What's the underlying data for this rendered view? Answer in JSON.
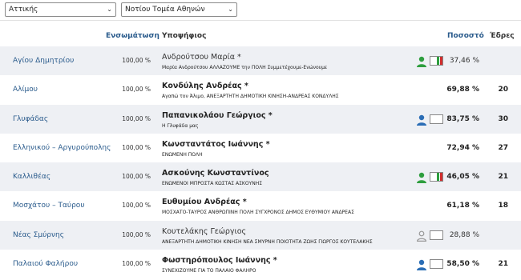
{
  "filters": {
    "region": "Αττικής",
    "sector": "Νοτίου Τομέα Αθηνών"
  },
  "header": {
    "integration": "Ενσωμάτωση",
    "candidate": "Υποψήφιος",
    "percentage": "Ποσοστό",
    "seats": "Έδρες"
  },
  "colors": {
    "link": "#2a5b8c",
    "row_alt": "#eef0f4",
    "elected_icon": "#2e9e3e",
    "leading_icon": "#2a6db5",
    "trailing_icon": "#999999",
    "bar_green": "#2e9e3e",
    "bar_red": "#d22d2d"
  },
  "rows": [
    {
      "municipality": "Αγίου Δημητρίου",
      "integration": "100,00 %",
      "candidate": "Ανδρούτσου Μαρία *",
      "party": "Μαρία Ανδρούτσου ΑΛΛΑΖΟΥΜΕ την ΠΟΛΗ Συμμετέχουμε-Ενώνουμε",
      "percent": "37,46 %",
      "seats": "",
      "icon": "green-person-icon",
      "bar": true,
      "bold": false
    },
    {
      "municipality": "Αλίμου",
      "integration": "100,00 %",
      "candidate": "Κονδύλης Ανδρέας *",
      "party": "Αγαπώ τον Άλιμο, ΑΝΕΞΑΡΤΗΤΗ ΔΗΜΟΤΙΚΗ ΚΙΝΗΣΗ-ΑΝΔΡΕΑΣ ΚΟΝΔΥΛΗΣ",
      "percent": "69,88 %",
      "seats": "20",
      "icon": "",
      "bar": false,
      "bold": true
    },
    {
      "municipality": "Γλυφάδας",
      "integration": "100,00 %",
      "candidate": "Παπανικολάου Γεώργιος *",
      "party": "Η Γλυφάδα μας",
      "percent": "83,75 %",
      "seats": "30",
      "icon": "blue-person-icon",
      "bar": false,
      "bold": true
    },
    {
      "municipality": "Ελληνικού – Αργυρούπολης",
      "integration": "100,00 %",
      "candidate": "Κωνσταντάτος Ιωάννης *",
      "party": "ΕΝΩΜΕΝΗ ΠΟΛΗ",
      "percent": "72,94 %",
      "seats": "27",
      "icon": "",
      "bar": false,
      "bold": true
    },
    {
      "municipality": "Καλλιθέας",
      "integration": "100,00 %",
      "candidate": "Ασκούνης Κωνσταντίνος",
      "party": "ΕΝΩΜΕΝΟΙ ΜΠΡΟΣΤΑ ΚΩΣΤΑΣ ΑΣΚΟΥΝΗΣ",
      "percent": "46,05 %",
      "seats": "21",
      "icon": "green-person-icon",
      "bar": true,
      "bold": true
    },
    {
      "municipality": "Μοσχάτου – Ταύρου",
      "integration": "100,00 %",
      "candidate": "Ευθυμίου Ανδρέας *",
      "party": "ΜΟΣΧΑΤΟ-ΤΑΥΡΟΣ ΑΝΘΡΩΠΙΝΗ ΠΟΛΗ ΣΥΓΧΡΟΝΟΣ ΔΗΜΟΣ ΕΥΘΥΜΙΟΥ ΑΝΔΡΕΑΣ",
      "percent": "61,18 %",
      "seats": "18",
      "icon": "",
      "bar": false,
      "bold": true
    },
    {
      "municipality": "Νέας Σμύρνης",
      "integration": "100,00 %",
      "candidate": "Κουτελάκης Γεώργιος",
      "party": "ΑΝΕΞΑΡΤΗΤΗ ΔΗΜΟΤΙΚΗ ΚΙΝΗΣΗ ΝΕΑ ΣΜΥΡΝΗ ΠΟΙΟΤΗΤΑ ΖΩΗΣ ΓΙΩΡΓΟΣ ΚΟΥΤΕΛΑΚΗΣ",
      "percent": "28,88 %",
      "seats": "",
      "icon": "gray-person-icon",
      "bar": false,
      "bold": false
    },
    {
      "municipality": "Παλαιού Φαλήρου",
      "integration": "100,00 %",
      "candidate": "Φωστηρόπουλος Ιωάννης *",
      "party": "ΣΥΝΕΧΙΖΟΥΜΕ ΓΙΑ ΤΟ ΠΑΛΑΙΟ ΦΑΛΗΡΟ",
      "percent": "58,50 %",
      "seats": "21",
      "icon": "blue-person-icon",
      "bar": false,
      "bold": true
    }
  ]
}
